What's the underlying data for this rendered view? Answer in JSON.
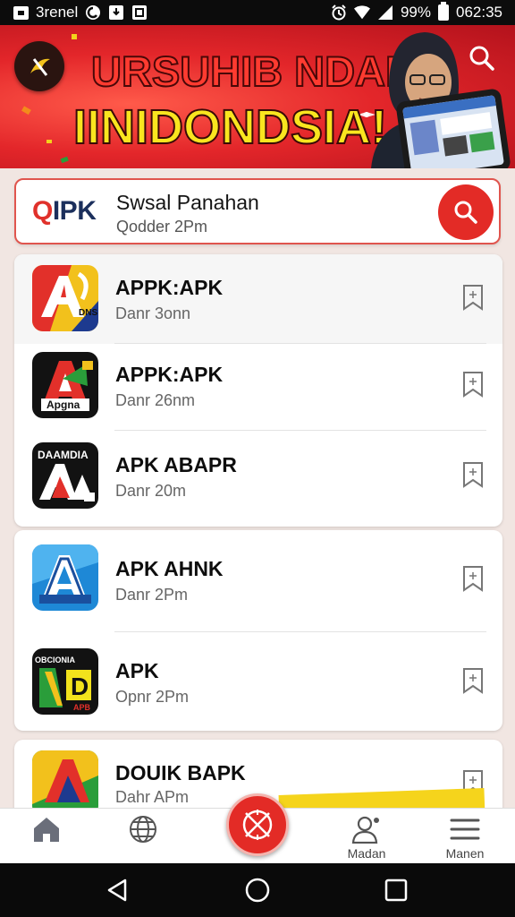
{
  "status_bar": {
    "carrier": "3renel",
    "battery": "99%",
    "time": "062:35"
  },
  "banner": {
    "headline_line1": "URSUHIB NDAN",
    "headline_line2": "IINIDONDSIA!."
  },
  "search_card": {
    "brand_q": "Q",
    "brand_ipk": "IPK",
    "title": "Swsal Panahan",
    "subtitle": "Qodder 2Pm"
  },
  "apps": [
    {
      "name": "APPK:APK",
      "meta": "Danr 3onn"
    },
    {
      "name": "APPK:APK",
      "meta": "Danr 26nm"
    },
    {
      "name": "APK ABAPR",
      "meta": "Danr 20m"
    },
    {
      "name": "APK AHNK",
      "meta": "Danr 2Pm"
    },
    {
      "name": "APK",
      "meta": "Opnr 2Pm"
    },
    {
      "name": "DOUIK BAPK",
      "meta": "Dahr APm"
    }
  ],
  "app_icon_text": {
    "i0": "DNS",
    "i1": "Apgna",
    "i2": "DAAMDIA",
    "i4": "OBCIONIA",
    "i4b": "D",
    "i4c": "APB"
  },
  "bottom_nav": {
    "home_label": "",
    "discover_label": "",
    "center_label": "",
    "profile_label": "Madan",
    "menu_label": "Manen"
  },
  "colors": {
    "accent": "#e32b26",
    "banner_yellow": "#f9e51f",
    "status_bar": "#0c0c0c"
  }
}
